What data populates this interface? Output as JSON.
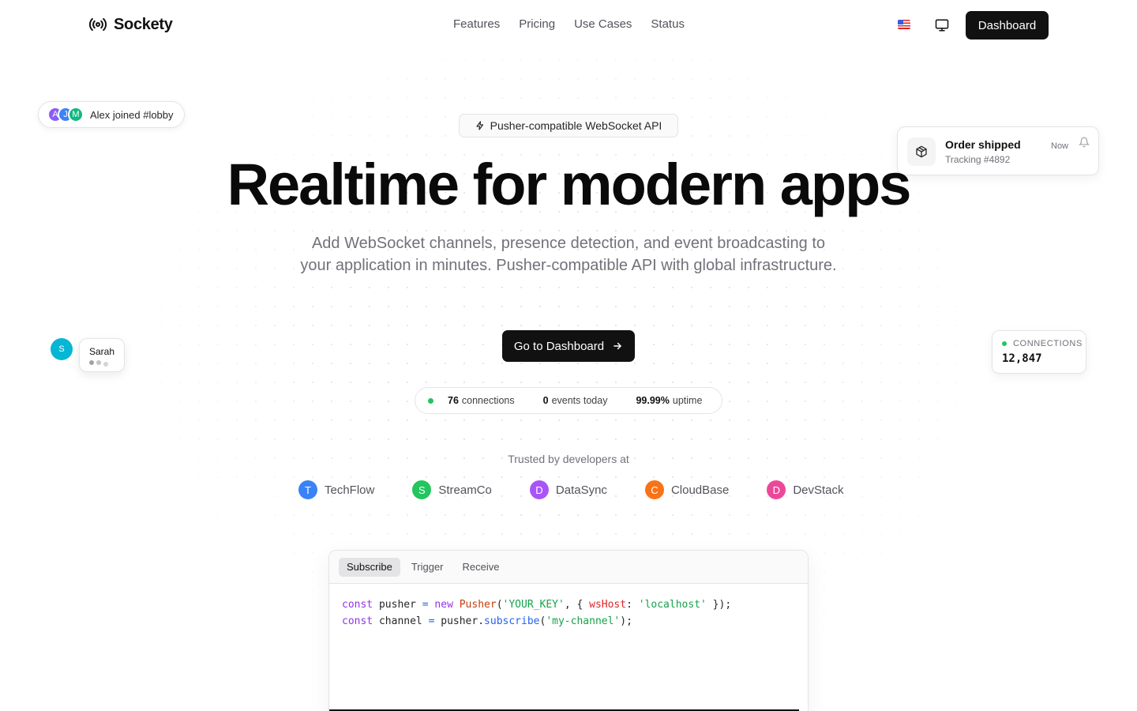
{
  "nav": {
    "brand": "Sockety",
    "links": [
      "Features",
      "Pricing",
      "Use Cases",
      "Status"
    ],
    "dashboard_label": "Dashboard"
  },
  "floating": {
    "join": {
      "avatars": [
        {
          "letter": "A",
          "color": "#8b5cf6"
        },
        {
          "letter": "J",
          "color": "#3b82f6"
        },
        {
          "letter": "M",
          "color": "#10b981"
        }
      ],
      "text": "Alex joined #lobby"
    },
    "order": {
      "title": "Order shipped",
      "subtitle": "Tracking #4892",
      "time": "Now"
    },
    "typing": {
      "avatar": "S",
      "name": "Sarah"
    },
    "connections": {
      "label": "CONNECTIONS",
      "value": "12,847"
    }
  },
  "hero": {
    "badge": "Pusher-compatible WebSocket API",
    "title": "Realtime for modern apps",
    "subtitle": "Add WebSocket channels, presence detection, and event broadcasting to your application in minutes. Pusher-compatible API with global infrastructure.",
    "cta": "Go to Dashboard"
  },
  "stats": {
    "connections_value": "76",
    "connections_label": "connections",
    "events_value": "0",
    "events_label": "events today",
    "uptime_value": "99.99%",
    "uptime_label": "uptime"
  },
  "trusted": {
    "label": "Trusted by developers at",
    "logos": [
      {
        "letter": "T",
        "name": "TechFlow",
        "color": "#3b82f6"
      },
      {
        "letter": "S",
        "name": "StreamCo",
        "color": "#22c55e"
      },
      {
        "letter": "D",
        "name": "DataSync",
        "color": "#a855f7"
      },
      {
        "letter": "C",
        "name": "CloudBase",
        "color": "#f97316"
      },
      {
        "letter": "D",
        "name": "DevStack",
        "color": "#ec4899"
      }
    ]
  },
  "code": {
    "tabs": [
      "Subscribe",
      "Trigger",
      "Receive"
    ],
    "active_tab": "Subscribe",
    "line1": {
      "kw1": "const",
      "var": "pusher",
      "eq": "=",
      "kw2": "new",
      "cls": "Pusher",
      "arg": "'YOUR_KEY'",
      "prop": "wsHost",
      "val": "'localhost'"
    },
    "line2": {
      "kw1": "const",
      "var": "channel",
      "eq": "=",
      "obj": "pusher",
      "fn": "subscribe",
      "arg": "'my-channel'"
    }
  },
  "colors": {
    "accent": "#111111",
    "live": "#22c55e",
    "muted": "#71717a"
  }
}
